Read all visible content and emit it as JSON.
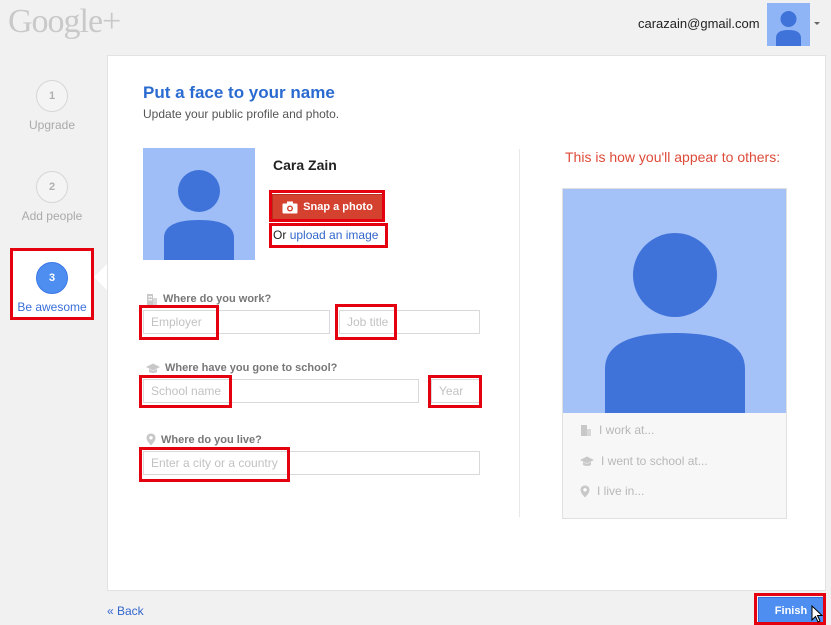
{
  "header": {
    "logo_text": "Google+",
    "account_email": "carazain@gmail.com"
  },
  "steps": [
    {
      "number": "1",
      "label": "Upgrade"
    },
    {
      "number": "2",
      "label": "Add people"
    },
    {
      "number": "3",
      "label": "Be awesome"
    }
  ],
  "main": {
    "title": "Put a face to your name",
    "subtitle": "Update your public profile and photo.",
    "name": "Cara Zain",
    "snap_photo_label": "Snap a photo",
    "upload_prefix": "Or",
    "upload_link": "upload an image",
    "work": {
      "question": "Where do you work?",
      "employer_placeholder": "Employer",
      "job_title_placeholder": "Job title"
    },
    "school": {
      "question": "Where have you gone to school?",
      "school_placeholder": "School name",
      "year_placeholder": "Year"
    },
    "live": {
      "question": "Where do you live?",
      "city_placeholder": "Enter a city or a country"
    }
  },
  "preview": {
    "heading": "This is how you'll appear to others:",
    "work": "I work at...",
    "school": "I went to school at...",
    "live": "I live in..."
  },
  "footer": {
    "back_label": "« Back",
    "finish_label": "Finish"
  },
  "colors": {
    "accent_blue": "#4d8ef0",
    "title_blue": "#2a6bd1",
    "snap_red": "#d4412f",
    "highlight_red": "#e5000f"
  }
}
